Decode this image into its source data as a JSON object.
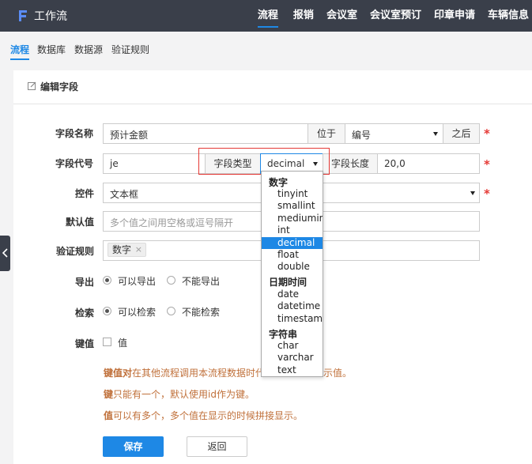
{
  "app": {
    "title": "工作流"
  },
  "topnav": [
    "流程",
    "报销",
    "会议室",
    "会议室预订",
    "印章申请",
    "车辆信息"
  ],
  "subtabs": [
    "流程",
    "数据库",
    "数据源",
    "验证规则"
  ],
  "panel": {
    "title": "编辑字段"
  },
  "form": {
    "field_name": {
      "label": "字段名称",
      "value": "预计金额",
      "position_label": "位于",
      "position_select": "编号",
      "after_label": "之后"
    },
    "field_code": {
      "label": "字段代号",
      "value": "je",
      "type_label": "字段类型",
      "type_value": "decimal",
      "length_label": "字段长度",
      "length_value": "20,0"
    },
    "control": {
      "label": "控件",
      "value": "文本框"
    },
    "default": {
      "label": "默认值",
      "placeholder": "多个值之间用空格或逗号隔开"
    },
    "validation": {
      "label": "验证规则",
      "tag": "数字",
      "tag_close": "×"
    },
    "export": {
      "label": "导出",
      "opt_yes": "可以导出",
      "opt_no": "不能导出"
    },
    "search": {
      "label": "检索",
      "opt_yes": "可以检索",
      "opt_no": "不能检索"
    },
    "keyvalue": {
      "label": "键值",
      "opt": "值"
    },
    "required_mark": "*"
  },
  "notes": {
    "line1_bold": "键值对",
    "line1_rest": "在其他流程调用本流程数据时代",
    "line1_tail": "示值。",
    "line2_bold": "键",
    "line2_rest": "只能有一个，默认使用id作为键。",
    "line3_bold": "值",
    "line3_rest": "可以有多个，多个值在显示的时候拼接显示。"
  },
  "buttons": {
    "save": "保存",
    "back": "返回"
  },
  "dropdown": {
    "groups": [
      {
        "name": "数字",
        "items": [
          "tinyint",
          "smallint",
          "mediumint",
          "int",
          "decimal",
          "float",
          "double"
        ]
      },
      {
        "name": "日期时间",
        "items": [
          "date",
          "datetime",
          "timestamp"
        ]
      },
      {
        "name": "字符串",
        "items": [
          "char",
          "varchar",
          "text"
        ]
      }
    ],
    "selected": "decimal"
  },
  "colors": {
    "accent": "#1e88e5",
    "topbar": "#3a3f4a",
    "required": "#e53935",
    "note": "#c0703a"
  }
}
